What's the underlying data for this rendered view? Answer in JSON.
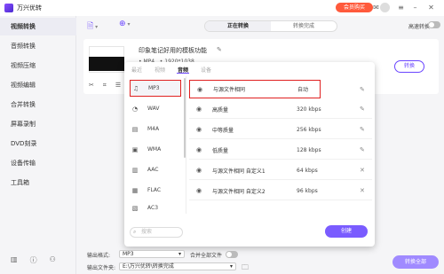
{
  "app": {
    "title": "万兴优转",
    "vip_button": "会员购买"
  },
  "titlebar_icons": [
    "gift-icon",
    "avatar",
    "menu-icon",
    "minimize-icon",
    "close-icon"
  ],
  "sidebar": {
    "items": [
      {
        "label": "视频转换",
        "active": true
      },
      {
        "label": "音频转换",
        "active": false
      },
      {
        "label": "视频压缩",
        "active": false
      },
      {
        "label": "视频编辑",
        "active": false
      },
      {
        "label": "合并转换",
        "active": false
      },
      {
        "label": "屏幕录制",
        "active": false
      },
      {
        "label": "DVD刻录",
        "active": false
      },
      {
        "label": "设备传输",
        "active": false
      },
      {
        "label": "工具箱",
        "active": false
      }
    ]
  },
  "topbar": {
    "tabs": [
      {
        "label": "正在转换",
        "active": true
      },
      {
        "label": "转换完成",
        "active": false
      }
    ],
    "high_speed_label": "高速转换"
  },
  "file": {
    "name": "印象笔记好用的模板功能",
    "meta_format": "MP4",
    "meta_resolution": "1920*1038",
    "convert_button": "转换"
  },
  "format_panel": {
    "tabs": [
      {
        "label": "最近",
        "active": false
      },
      {
        "label": "视频",
        "active": false
      },
      {
        "label": "音频",
        "active": true
      },
      {
        "label": "设备",
        "active": false
      }
    ],
    "formats": [
      {
        "label": "MP3",
        "icon": "music-note-icon",
        "selected": true
      },
      {
        "label": "WAV",
        "icon": "wave-icon",
        "selected": false
      },
      {
        "label": "M4A",
        "icon": "audio-file-icon",
        "selected": false
      },
      {
        "label": "WMA",
        "icon": "audio-file-icon",
        "selected": false
      },
      {
        "label": "AAC",
        "icon": "audio-file-icon",
        "selected": false
      },
      {
        "label": "FLAC",
        "icon": "audio-file-icon",
        "selected": false
      },
      {
        "label": "AC3",
        "icon": "audio-file-icon",
        "selected": false
      }
    ],
    "qualities": [
      {
        "name": "与源文件相同",
        "rate": "自动",
        "action": "edit",
        "selected": true
      },
      {
        "name": "高质量",
        "rate": "320 kbps",
        "action": "edit",
        "selected": false
      },
      {
        "name": "中等质量",
        "rate": "256 kbps",
        "action": "edit",
        "selected": false
      },
      {
        "name": "低质量",
        "rate": "128 kbps",
        "action": "edit",
        "selected": false
      },
      {
        "name": "与源文件相同 自定义1",
        "rate": "64 kbps",
        "action": "delete",
        "selected": false
      },
      {
        "name": "与源文件相同 自定义2",
        "rate": "96 kbps",
        "action": "delete",
        "selected": false
      }
    ],
    "search_placeholder": "搜索",
    "create_button": "创建"
  },
  "bottom": {
    "output_format_label": "输出格式:",
    "output_format_value": "MP3",
    "merge_label": "合并全部文件",
    "output_folder_label": "输出文件夹:",
    "output_folder_value": "E:\\万兴优转\\转换完成",
    "convert_all_button": "转换全部"
  },
  "colors": {
    "accent": "#6a45ff",
    "highlight": "#e02020",
    "vip": "#ff5a3c"
  }
}
